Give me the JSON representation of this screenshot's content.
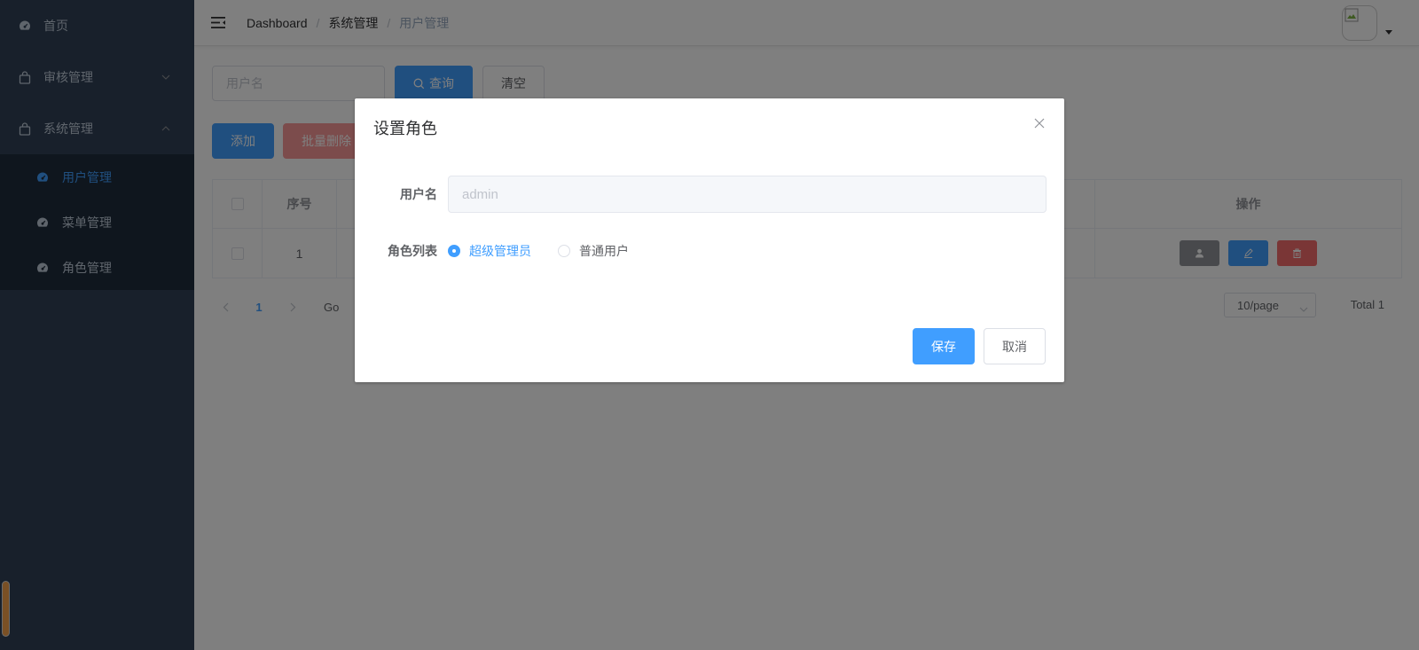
{
  "sidebar": {
    "items": [
      {
        "label": "首页",
        "icon": "dashboard-icon"
      },
      {
        "label": "审核管理",
        "icon": "shopping-bag-icon",
        "expanded": false
      },
      {
        "label": "系统管理",
        "icon": "shopping-bag-icon",
        "expanded": true
      }
    ],
    "submenu": [
      {
        "label": "用户管理",
        "icon": "dashboard-icon",
        "active": true
      },
      {
        "label": "菜单管理",
        "icon": "dashboard-icon"
      },
      {
        "label": "角色管理",
        "icon": "dashboard-icon"
      }
    ],
    "colors": {
      "bg": "#304156",
      "submenu_bg": "#1f2d3d",
      "text": "#bfcbd9",
      "active": "#409eff"
    }
  },
  "navbar": {
    "breadcrumb": [
      "Dashboard",
      "系统管理",
      "用户管理"
    ],
    "separator": "/"
  },
  "search": {
    "placeholder": "用户名",
    "query_label": "查询",
    "clear_label": "清空"
  },
  "actions": {
    "add_label": "添加",
    "batch_delete_label": "批量删除"
  },
  "table": {
    "headers": {
      "index": "序号",
      "operations": "操作"
    },
    "rows": [
      {
        "index": "1"
      }
    ]
  },
  "pagination": {
    "current_page": "1",
    "goto_label": "Go",
    "page_size": "10/page",
    "total": "Total 1"
  },
  "dialog": {
    "title": "设置角色",
    "username_label": "用户名",
    "username_value": "admin",
    "roles_label": "角色列表",
    "roles": [
      {
        "label": "超级管理员",
        "checked": true
      },
      {
        "label": "普通用户",
        "checked": false
      }
    ],
    "save_label": "保存",
    "cancel_label": "取消"
  }
}
